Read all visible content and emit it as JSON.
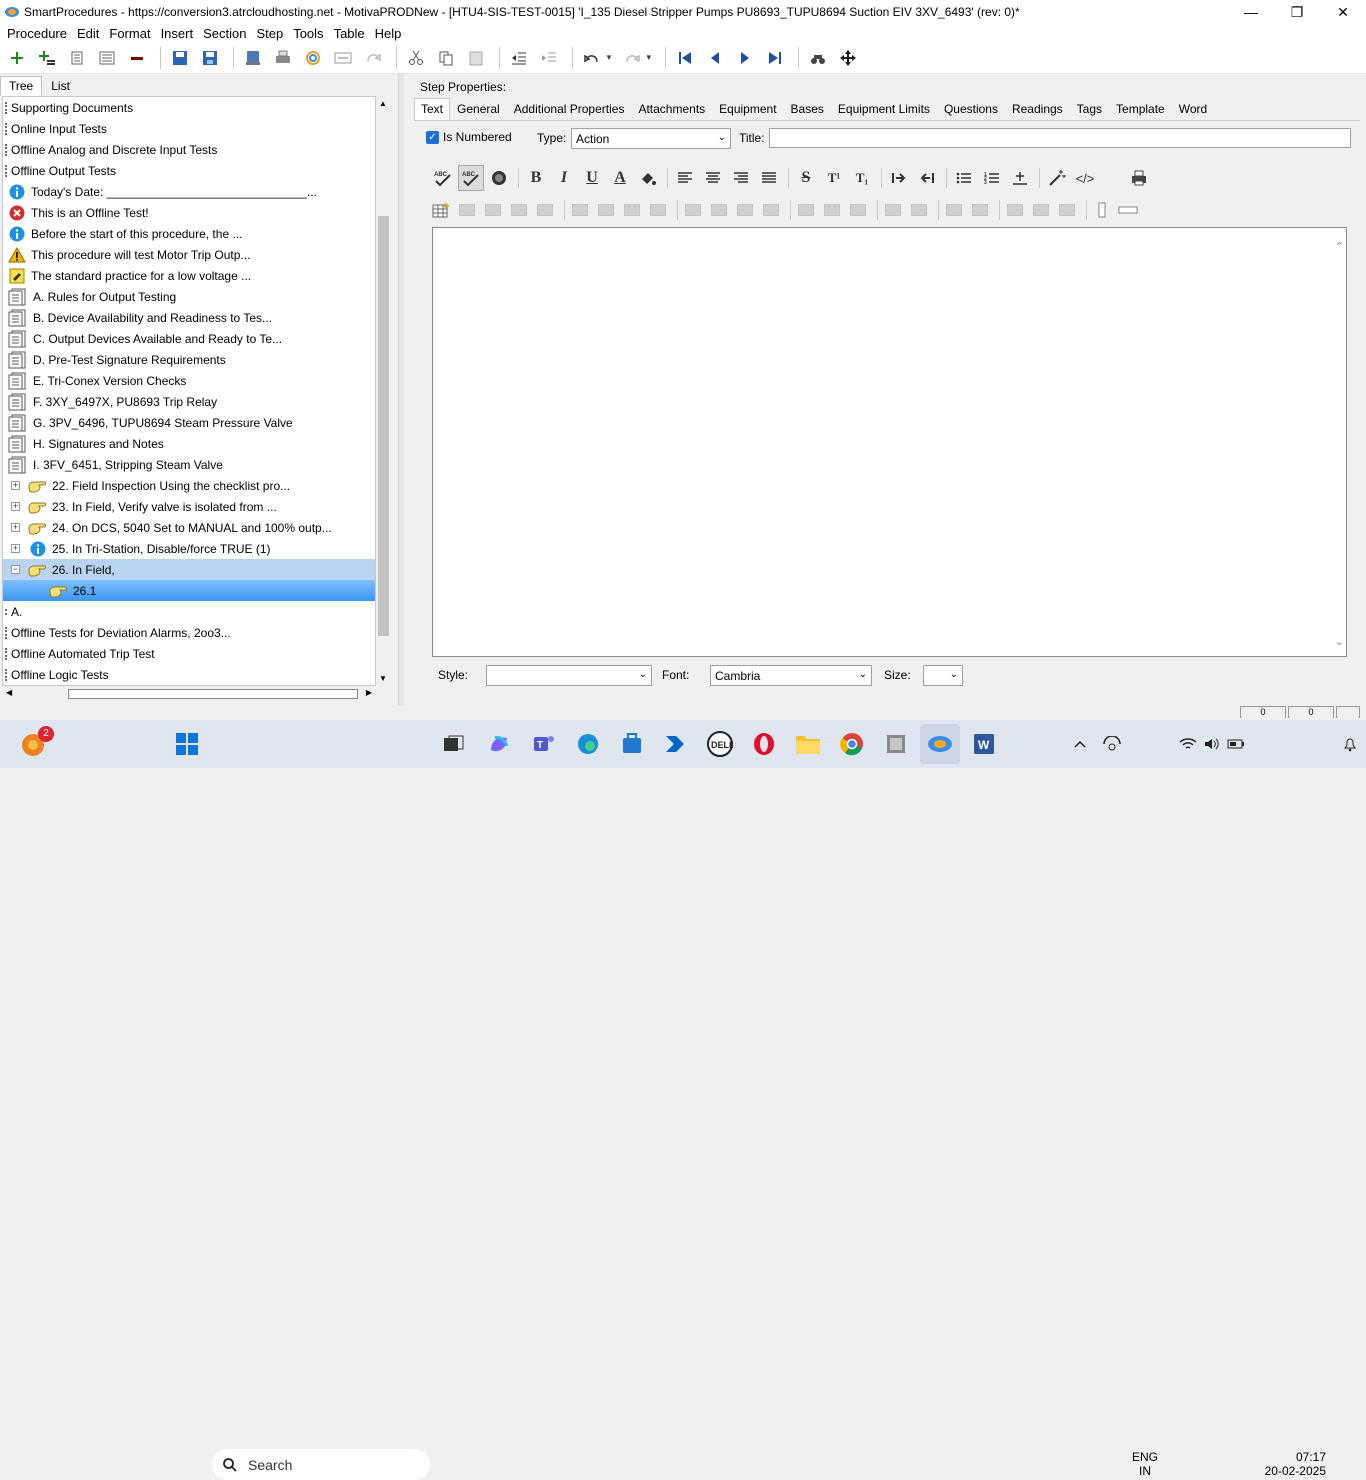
{
  "window": {
    "title": "SmartProcedures - https://conversion3.atrcloudhosting.net - MotivaPRODNew - [HTU4-SIS-TEST-0015] 'I_135 Diesel Stripper Pumps PU8693_TUPU8694 Suction EIV 3XV_6493' (rev: 0)*",
    "minimize": "—",
    "maximize": "❐",
    "close": "✕"
  },
  "menu": [
    "Procedure",
    "Edit",
    "Format",
    "Insert",
    "Section",
    "Step",
    "Tools",
    "Table",
    "Help"
  ],
  "left_tabs": {
    "tree": "Tree",
    "list": "List"
  },
  "tree": [
    {
      "label": "Supporting Documents",
      "icon": "folder-tick",
      "indent": 0
    },
    {
      "label": "Online Input Tests",
      "icon": "folder-tick",
      "indent": 0
    },
    {
      "label": "Offline Analog and Discrete Input Tests",
      "icon": "folder-tick",
      "indent": 0
    },
    {
      "label": "Offline Output Tests",
      "icon": "folder-tick",
      "indent": 0
    },
    {
      "label": "Today's Date: ______________________________...",
      "icon": "info-icon",
      "indent": 1
    },
    {
      "label": "This is an Offline Test!",
      "icon": "error-icon",
      "indent": 1
    },
    {
      "label": "Before the start of this procedure, the ...",
      "icon": "info-icon",
      "indent": 1
    },
    {
      "label": "This procedure will test Motor Trip Outp...",
      "icon": "warning-icon",
      "indent": 1
    },
    {
      "label": "The standard practice for a low voltage ...",
      "icon": "note-icon",
      "indent": 1
    },
    {
      "label": "A. Rules for Output Testing",
      "icon": "document-icon",
      "indent": 1
    },
    {
      "label": "B. Device Availability and Readiness to Tes...",
      "icon": "document-icon",
      "indent": 1
    },
    {
      "label": "C. Output Devices Available and Ready to Te...",
      "icon": "document-icon",
      "indent": 1
    },
    {
      "label": "D. Pre-Test Signature Requirements",
      "icon": "document-icon",
      "indent": 1
    },
    {
      "label": "E. Tri-Conex Version Checks",
      "icon": "document-icon",
      "indent": 1
    },
    {
      "label": "F. 3XY_6497X, PU8693 Trip Relay",
      "icon": "document-icon",
      "indent": 1
    },
    {
      "label": "G. 3PV_6496, TUPU8694 Steam Pressure Valve",
      "icon": "document-icon",
      "indent": 1
    },
    {
      "label": "H. Signatures and Notes",
      "icon": "document-icon",
      "indent": 1
    },
    {
      "label": "I. 3FV_6451, Stripping Steam Valve",
      "icon": "document-icon",
      "indent": 1
    },
    {
      "label": "22. Field Inspection Using the checklist pro...",
      "icon": "hand-icon",
      "indent": 2,
      "expander": "+"
    },
    {
      "label": "23. In Field, Verify valve is isolated from ...",
      "icon": "hand-icon",
      "indent": 2,
      "expander": "+"
    },
    {
      "label": "24. On DCS, 5040 Set to MANUAL and 100% outp...",
      "icon": "hand-icon",
      "indent": 2,
      "expander": "+"
    },
    {
      "label": "25. In Tri-Station, Disable/force TRUE (1)",
      "icon": "info-icon",
      "indent": 2,
      "expander": "+"
    },
    {
      "label": "26. In Field,",
      "icon": "hand-icon",
      "indent": 2,
      "expander": "−",
      "state": "selected"
    },
    {
      "label": "26.1",
      "icon": "hand-icon",
      "indent": 3,
      "state": "selected2"
    },
    {
      "label": "A.",
      "icon": "none",
      "indent": 0,
      "small_tick": true
    },
    {
      "label": "Offline Tests for Deviation Alarms, 2oo3...",
      "icon": "folder-tick",
      "indent": 0
    },
    {
      "label": "Offline Automated Trip Test",
      "icon": "folder-tick",
      "indent": 0
    },
    {
      "label": "Offline Logic Tests",
      "icon": "folder-tick",
      "indent": 0
    }
  ],
  "step_properties_label": "Step Properties:",
  "right_tabs": [
    "Text",
    "General",
    "Additional Properties",
    "Attachments",
    "Equipment",
    "Bases",
    "Equipment Limits",
    "Questions",
    "Readings",
    "Tags",
    "Template",
    "Word"
  ],
  "form": {
    "is_numbered_label": "Is Numbered",
    "is_numbered_checked": true,
    "type_label": "Type:",
    "type_value": "Action",
    "title_label": "Title:",
    "title_value": ""
  },
  "format_buttons": {
    "bold": "B",
    "italic": "I",
    "underline": "U",
    "font_color": "A",
    "strike": "S",
    "superscript": "T¹",
    "subscript": "T₁",
    "code": "</>"
  },
  "bottom": {
    "style_label": "Style:",
    "style_value": "",
    "font_label": "Font:",
    "font_value": "Cambria",
    "size_label": "Size:",
    "size_value": ""
  },
  "status_boxes": [
    "0",
    "0",
    ""
  ],
  "taskbar": {
    "search_placeholder": "Search",
    "notification_count": "2",
    "lang_top": "ENG",
    "lang_bottom": "IN",
    "time": "07:17",
    "date": "20-02-2025"
  },
  "colors": {
    "selection": "#b8d4f0",
    "selection_active": "#3d96ef",
    "accent": "#1f6fd1"
  }
}
